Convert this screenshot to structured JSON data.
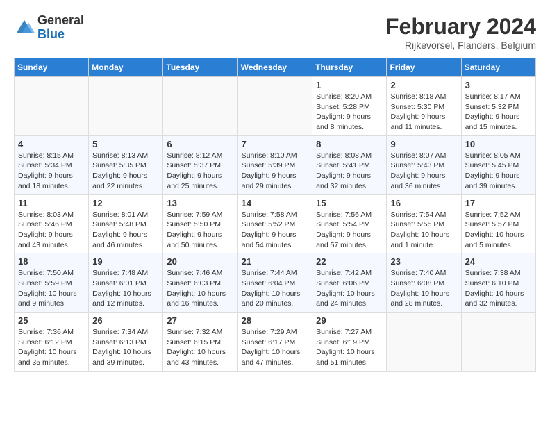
{
  "header": {
    "logo_general": "General",
    "logo_blue": "Blue",
    "month_title": "February 2024",
    "location": "Rijkevorsel, Flanders, Belgium"
  },
  "weekdays": [
    "Sunday",
    "Monday",
    "Tuesday",
    "Wednesday",
    "Thursday",
    "Friday",
    "Saturday"
  ],
  "weeks": [
    [
      {
        "day": "",
        "sunrise": "",
        "sunset": "",
        "daylight": ""
      },
      {
        "day": "",
        "sunrise": "",
        "sunset": "",
        "daylight": ""
      },
      {
        "day": "",
        "sunrise": "",
        "sunset": "",
        "daylight": ""
      },
      {
        "day": "",
        "sunrise": "",
        "sunset": "",
        "daylight": ""
      },
      {
        "day": "1",
        "sunrise": "Sunrise: 8:20 AM",
        "sunset": "Sunset: 5:28 PM",
        "daylight": "Daylight: 9 hours and 8 minutes."
      },
      {
        "day": "2",
        "sunrise": "Sunrise: 8:18 AM",
        "sunset": "Sunset: 5:30 PM",
        "daylight": "Daylight: 9 hours and 11 minutes."
      },
      {
        "day": "3",
        "sunrise": "Sunrise: 8:17 AM",
        "sunset": "Sunset: 5:32 PM",
        "daylight": "Daylight: 9 hours and 15 minutes."
      }
    ],
    [
      {
        "day": "4",
        "sunrise": "Sunrise: 8:15 AM",
        "sunset": "Sunset: 5:34 PM",
        "daylight": "Daylight: 9 hours and 18 minutes."
      },
      {
        "day": "5",
        "sunrise": "Sunrise: 8:13 AM",
        "sunset": "Sunset: 5:35 PM",
        "daylight": "Daylight: 9 hours and 22 minutes."
      },
      {
        "day": "6",
        "sunrise": "Sunrise: 8:12 AM",
        "sunset": "Sunset: 5:37 PM",
        "daylight": "Daylight: 9 hours and 25 minutes."
      },
      {
        "day": "7",
        "sunrise": "Sunrise: 8:10 AM",
        "sunset": "Sunset: 5:39 PM",
        "daylight": "Daylight: 9 hours and 29 minutes."
      },
      {
        "day": "8",
        "sunrise": "Sunrise: 8:08 AM",
        "sunset": "Sunset: 5:41 PM",
        "daylight": "Daylight: 9 hours and 32 minutes."
      },
      {
        "day": "9",
        "sunrise": "Sunrise: 8:07 AM",
        "sunset": "Sunset: 5:43 PM",
        "daylight": "Daylight: 9 hours and 36 minutes."
      },
      {
        "day": "10",
        "sunrise": "Sunrise: 8:05 AM",
        "sunset": "Sunset: 5:45 PM",
        "daylight": "Daylight: 9 hours and 39 minutes."
      }
    ],
    [
      {
        "day": "11",
        "sunrise": "Sunrise: 8:03 AM",
        "sunset": "Sunset: 5:46 PM",
        "daylight": "Daylight: 9 hours and 43 minutes."
      },
      {
        "day": "12",
        "sunrise": "Sunrise: 8:01 AM",
        "sunset": "Sunset: 5:48 PM",
        "daylight": "Daylight: 9 hours and 46 minutes."
      },
      {
        "day": "13",
        "sunrise": "Sunrise: 7:59 AM",
        "sunset": "Sunset: 5:50 PM",
        "daylight": "Daylight: 9 hours and 50 minutes."
      },
      {
        "day": "14",
        "sunrise": "Sunrise: 7:58 AM",
        "sunset": "Sunset: 5:52 PM",
        "daylight": "Daylight: 9 hours and 54 minutes."
      },
      {
        "day": "15",
        "sunrise": "Sunrise: 7:56 AM",
        "sunset": "Sunset: 5:54 PM",
        "daylight": "Daylight: 9 hours and 57 minutes."
      },
      {
        "day": "16",
        "sunrise": "Sunrise: 7:54 AM",
        "sunset": "Sunset: 5:55 PM",
        "daylight": "Daylight: 10 hours and 1 minute."
      },
      {
        "day": "17",
        "sunrise": "Sunrise: 7:52 AM",
        "sunset": "Sunset: 5:57 PM",
        "daylight": "Daylight: 10 hours and 5 minutes."
      }
    ],
    [
      {
        "day": "18",
        "sunrise": "Sunrise: 7:50 AM",
        "sunset": "Sunset: 5:59 PM",
        "daylight": "Daylight: 10 hours and 9 minutes."
      },
      {
        "day": "19",
        "sunrise": "Sunrise: 7:48 AM",
        "sunset": "Sunset: 6:01 PM",
        "daylight": "Daylight: 10 hours and 12 minutes."
      },
      {
        "day": "20",
        "sunrise": "Sunrise: 7:46 AM",
        "sunset": "Sunset: 6:03 PM",
        "daylight": "Daylight: 10 hours and 16 minutes."
      },
      {
        "day": "21",
        "sunrise": "Sunrise: 7:44 AM",
        "sunset": "Sunset: 6:04 PM",
        "daylight": "Daylight: 10 hours and 20 minutes."
      },
      {
        "day": "22",
        "sunrise": "Sunrise: 7:42 AM",
        "sunset": "Sunset: 6:06 PM",
        "daylight": "Daylight: 10 hours and 24 minutes."
      },
      {
        "day": "23",
        "sunrise": "Sunrise: 7:40 AM",
        "sunset": "Sunset: 6:08 PM",
        "daylight": "Daylight: 10 hours and 28 minutes."
      },
      {
        "day": "24",
        "sunrise": "Sunrise: 7:38 AM",
        "sunset": "Sunset: 6:10 PM",
        "daylight": "Daylight: 10 hours and 32 minutes."
      }
    ],
    [
      {
        "day": "25",
        "sunrise": "Sunrise: 7:36 AM",
        "sunset": "Sunset: 6:12 PM",
        "daylight": "Daylight: 10 hours and 35 minutes."
      },
      {
        "day": "26",
        "sunrise": "Sunrise: 7:34 AM",
        "sunset": "Sunset: 6:13 PM",
        "daylight": "Daylight: 10 hours and 39 minutes."
      },
      {
        "day": "27",
        "sunrise": "Sunrise: 7:32 AM",
        "sunset": "Sunset: 6:15 PM",
        "daylight": "Daylight: 10 hours and 43 minutes."
      },
      {
        "day": "28",
        "sunrise": "Sunrise: 7:29 AM",
        "sunset": "Sunset: 6:17 PM",
        "daylight": "Daylight: 10 hours and 47 minutes."
      },
      {
        "day": "29",
        "sunrise": "Sunrise: 7:27 AM",
        "sunset": "Sunset: 6:19 PM",
        "daylight": "Daylight: 10 hours and 51 minutes."
      },
      {
        "day": "",
        "sunrise": "",
        "sunset": "",
        "daylight": ""
      },
      {
        "day": "",
        "sunrise": "",
        "sunset": "",
        "daylight": ""
      }
    ]
  ]
}
